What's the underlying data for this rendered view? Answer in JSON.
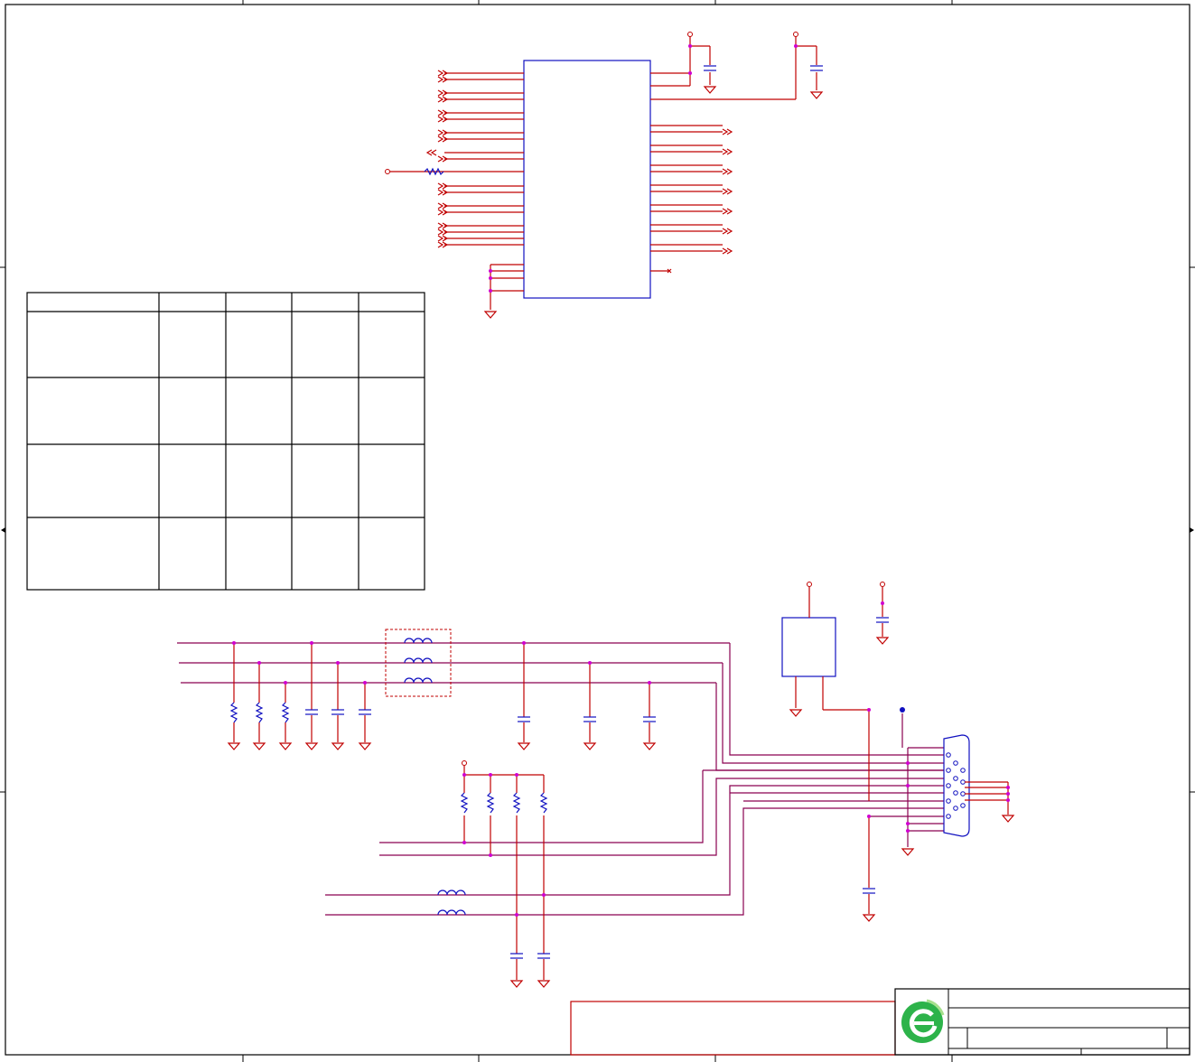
{
  "sheet": {
    "border_color": "#000000",
    "wire_color": "#c00000",
    "bus_color": "#8a0050",
    "component_color": "#1010c0",
    "junction_color": "#d000d0"
  },
  "logo": {
    "icon": "circular-e-logo-icon",
    "colors": [
      "#2db34a",
      "#a6e08c"
    ]
  },
  "title_block": {
    "rows": 3,
    "has_text": false
  },
  "config_table": {
    "columns": 5,
    "rows": 5,
    "cells": []
  },
  "connector": {
    "icon": "db9-connector-icon",
    "pins": 9
  }
}
